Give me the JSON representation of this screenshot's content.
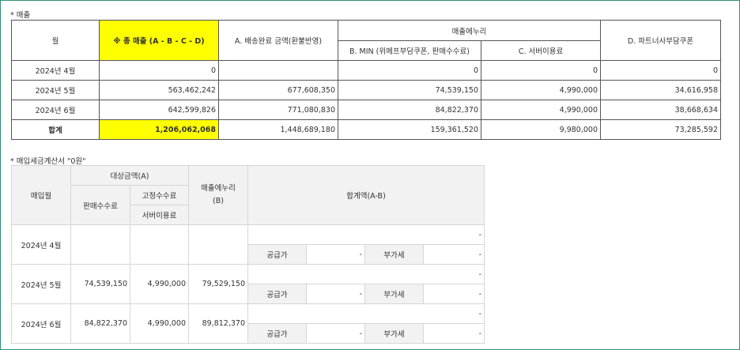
{
  "sales": {
    "title": "* 매출",
    "headers": {
      "month": "월",
      "total": "※ 총 매출 (A - B - C - D)",
      "a": "A. 배송완료 금액(환불반영)",
      "margin_group": "매출에누리",
      "b": "B. MIN (위메프부담쿠폰, 판매수수료)",
      "c": "C. 서버이용료",
      "d": "D. 파트너사부담쿠폰"
    },
    "rows": [
      {
        "month": "2024년 4월",
        "total": "0",
        "a": "",
        "b": "0",
        "c": "0",
        "d": "0"
      },
      {
        "month": "2024년 5월",
        "total": "563,462,242",
        "a": "677,608,350",
        "b": "74,539,150",
        "c": "4,990,000",
        "d": "34,616,958"
      },
      {
        "month": "2024년 6월",
        "total": "642,599,826",
        "a": "771,080,830",
        "b": "84,822,370",
        "c": "4,990,000",
        "d": "38,668,634"
      }
    ],
    "total_row": {
      "month": "합계",
      "total": "1,206,062,068",
      "a": "1,448,689,180",
      "b": "159,361,520",
      "c": "9,980,000",
      "d": "73,285,592"
    }
  },
  "purchase": {
    "title": "* 매입세금계산서 \"0원\"",
    "headers": {
      "month": "매입월",
      "target_group": "대상금액(A)",
      "sales_fee": "판매수수료",
      "fixed_fee": "고정수수료",
      "server_fee": "서버이용료",
      "margin": "매출에누리\n(B)",
      "sum": "합계액(A-B)"
    },
    "labels": {
      "supply": "공급가",
      "vat": "부가세"
    },
    "rows": [
      {
        "month": "2024년 4월",
        "sales_fee": "",
        "server_fee": "",
        "margin": "",
        "sum": "-",
        "supply": "-",
        "vat": "-"
      },
      {
        "month": "2024년 5월",
        "sales_fee": "74,539,150",
        "server_fee": "4,990,000",
        "margin": "79,529,150",
        "sum": "-",
        "supply": "-",
        "vat": "-"
      },
      {
        "month": "2024년 6월",
        "sales_fee": "84,822,370",
        "server_fee": "4,990,000",
        "margin": "89,812,370",
        "sum": "-",
        "supply": "-",
        "vat": "-"
      }
    ]
  }
}
